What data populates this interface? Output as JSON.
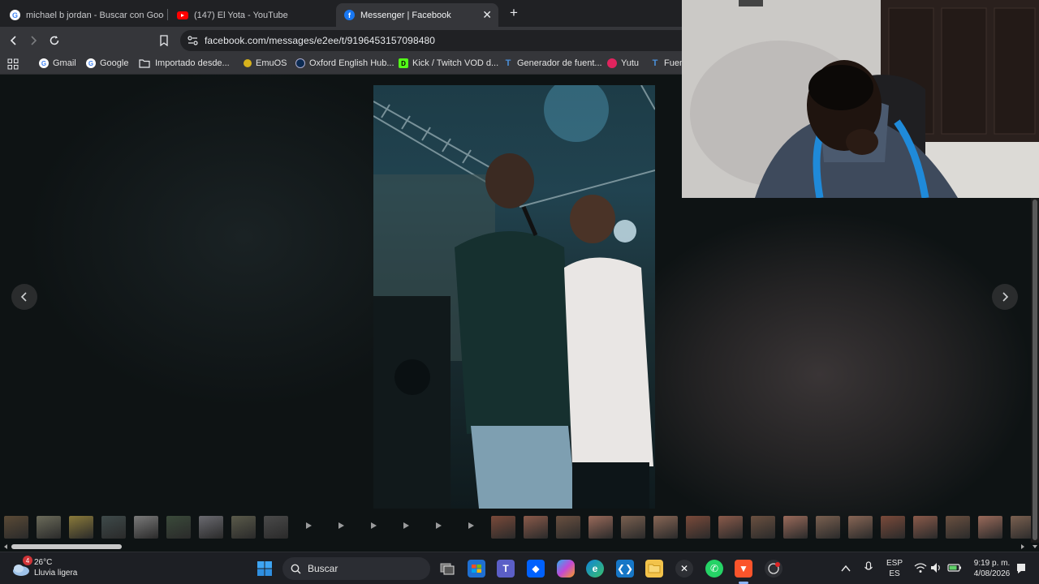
{
  "browser": {
    "tabs": [
      {
        "title": "michael b jordan - Buscar con Googl",
        "icon": "google-icon",
        "active": false
      },
      {
        "title": "(147) El Yota - YouTube",
        "icon": "youtube-icon",
        "active": false
      },
      {
        "title": "Messenger | Facebook",
        "icon": "facebook-icon",
        "active": true
      }
    ],
    "url": "facebook.com/messages/e2ee/t/9196453157098480",
    "bookmarks": [
      {
        "label": "Gmail",
        "icon": "google-icon"
      },
      {
        "label": "Google",
        "icon": "google-icon"
      },
      {
        "label": "Importado desde...",
        "icon": "folder-icon"
      },
      {
        "label": "EmuOS",
        "icon": "emuos-icon"
      },
      {
        "label": "Oxford English Hub...",
        "icon": "oxford-icon"
      },
      {
        "label": "Kick / Twitch VOD d...",
        "icon": "kick-icon"
      },
      {
        "label": "Generador de fuent...",
        "icon": "font-generator-icon"
      },
      {
        "label": "Yutu",
        "icon": "yutu-icon"
      },
      {
        "label": "Fuen",
        "icon": "font-generator-icon"
      }
    ]
  },
  "taskbar": {
    "weather": {
      "temp": "26°C",
      "condition": "Lluvia ligera",
      "badge": "4"
    },
    "search_placeholder": "Buscar",
    "language": {
      "top": "ESP",
      "bottom": "ES"
    },
    "clock": {
      "time": "9:19 p. m.",
      "date": "4/08/2026"
    }
  },
  "colors": {
    "accent_facebook": "#1877f2",
    "taskbar_bg": "#1d1f24",
    "chrome_bg": "#35363a"
  }
}
